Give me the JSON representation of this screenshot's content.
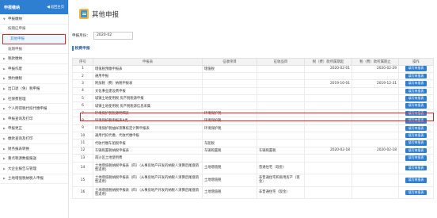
{
  "sidebar": {
    "header": "申报缴纳",
    "back_label": "返回主页",
    "items": [
      {
        "label": "申报缴纳",
        "type": "group",
        "tri": "▼"
      },
      {
        "label": "按期应申报",
        "type": "sub"
      },
      {
        "label": "其他申报",
        "type": "active"
      },
      {
        "label": "逾期申报",
        "type": "sub"
      },
      {
        "label": "税款缴纳",
        "type": "group",
        "tri": "▶"
      },
      {
        "label": "申报作废",
        "type": "group",
        "tri": "▶"
      },
      {
        "label": "预约缴税",
        "type": "group",
        "tri": "▶"
      },
      {
        "label": "出口退（免）税申报",
        "type": "group",
        "tri": "▶"
      },
      {
        "label": "社保费管理",
        "type": "group",
        "tri": "▶"
      },
      {
        "label": "个人所得税代扣代缴申报",
        "type": "group",
        "tri": "▶"
      },
      {
        "label": "申报查询及打印",
        "type": "group",
        "tri": "▶"
      },
      {
        "label": "申报更正",
        "type": "group",
        "tri": "▶"
      },
      {
        "label": "缴款查询及打印",
        "type": "group",
        "tri": "▶"
      },
      {
        "label": "财务报表转换",
        "type": "group",
        "tri": "▶"
      },
      {
        "label": "重点税源数据报送",
        "type": "group",
        "tri": "▶"
      },
      {
        "label": "大企业报告与管理",
        "type": "group",
        "tri": "▶"
      },
      {
        "label": "土地增值税纳税人申报",
        "type": "group",
        "tri": "▶"
      }
    ]
  },
  "page": {
    "title": "其他申报",
    "month_label": "申报月份：",
    "month_value": "2020-02",
    "section_title": "税费申报"
  },
  "table": {
    "headers": [
      "序号",
      "申报表",
      "征收项目",
      "征收品目",
      "税（费）款所属期起",
      "税（费）款所属期止",
      "操作"
    ],
    "op_label": "填写申报表",
    "rows": [
      {
        "no": "1",
        "form": "增值税预缴申报表",
        "item": "增值税",
        "sub": "",
        "start": "2020-02-01",
        "end": "2020-02-29",
        "op": true
      },
      {
        "no": "2",
        "form": "通用申报",
        "item": "",
        "sub": "",
        "start": "",
        "end": "",
        "op": true
      },
      {
        "no": "3",
        "form": "附加税（费）纳税申报表",
        "item": "",
        "sub": "",
        "start": "2019-10-01",
        "end": "2019-12-31",
        "op": true
      },
      {
        "no": "4",
        "form": "文化事业建设费申报",
        "item": "",
        "sub": "",
        "start": "",
        "end": "",
        "op": true
      },
      {
        "no": "5",
        "form": "城镇土地使用税 房产税税源申报",
        "item": "",
        "sub": "",
        "start": "",
        "end": "",
        "op": true
      },
      {
        "no": "6",
        "form": "城镇土地使用税 房产税税源信息采集",
        "item": "",
        "sub": "",
        "start": "",
        "end": "",
        "op": true
      },
      {
        "no": "7",
        "form": "环境保护税税源明细表",
        "item": "环境保护税",
        "sub": "",
        "start": "",
        "end": "",
        "op": true
      },
      {
        "no": "8",
        "form": "环境保护税申报表A类",
        "item": "环境保护税",
        "sub": "",
        "start": "",
        "end": "",
        "op": true
      },
      {
        "no": "9",
        "form": "环境保护税抽样测算核定计算申报表",
        "item": "环境保护税",
        "sub": "",
        "start": "",
        "end": "",
        "op": true
      },
      {
        "no": "10",
        "form": "通用代扣代缴、代收代缴申报",
        "item": "",
        "sub": "",
        "start": "",
        "end": "",
        "op": true
      },
      {
        "no": "11",
        "form": "代收代缴车船税申报",
        "item": "车船税",
        "sub": "",
        "start": "",
        "end": "",
        "op": true
      },
      {
        "no": "12",
        "form": "车辆购置税纳税申报表",
        "item": "车辆购置税",
        "sub": "车辆购置税",
        "start": "2020-02-18",
        "end": "2020-02-18",
        "op": true
      },
      {
        "no": "13",
        "form": "南沙区土地使用费",
        "item": "",
        "sub": "",
        "start": "",
        "end": "",
        "op": true
      },
      {
        "no": "14",
        "form": "土地增值税纳税申报表（四）（从事房地产开发的纳税人清算后尾盘销售适用）",
        "item": "土地增值税",
        "sub": "普通住宅（现金）",
        "start": "",
        "end": "",
        "op": true,
        "tall": true
      },
      {
        "no": "15",
        "form": "土地增值税纳税申报表（四）（从事房地产开发的纳税人清算后尾盘销售适用）",
        "item": "土地增值税",
        "sub": "非普通住宅和商用房产（现金）",
        "start": "",
        "end": "",
        "op": true,
        "tall": true
      },
      {
        "no": "16",
        "form": "土地增值税纳税申报表（四）（从事房地产开发的纳税人清算后尾盘销售适用）",
        "item": "土地增值税",
        "sub": "非普通住宅（现金）",
        "start": "",
        "end": "",
        "op": true,
        "tall": true
      }
    ]
  }
}
